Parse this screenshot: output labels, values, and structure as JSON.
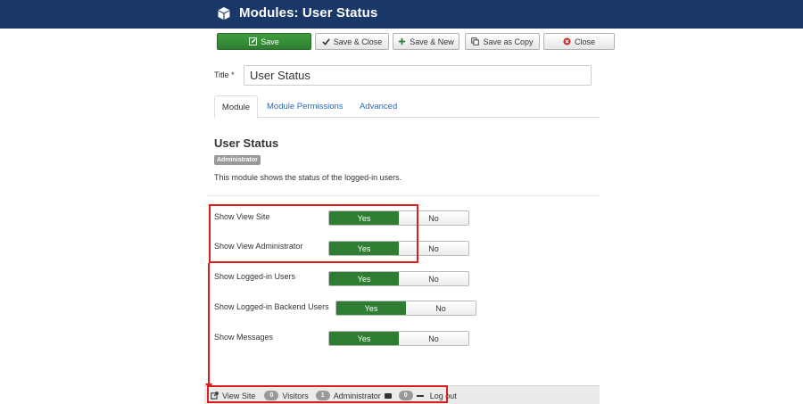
{
  "header": {
    "title": "Modules: User Status"
  },
  "toolbar": {
    "save": "Save",
    "save_close": "Save & Close",
    "save_new": "Save & New",
    "save_copy": "Save as Copy",
    "close": "Close"
  },
  "form": {
    "title_label": "Title *",
    "title_value": "User Status"
  },
  "tabs": [
    "Module",
    "Module Permissions",
    "Advanced"
  ],
  "module": {
    "heading": "User Status",
    "client_badge": "Administrator",
    "description": "This module shows the status of the logged-in users."
  },
  "options": [
    {
      "label": "Show View Site",
      "yes": "Yes",
      "no": "No",
      "value": "Yes"
    },
    {
      "label": "Show View Administrator",
      "yes": "Yes",
      "no": "No",
      "value": "Yes"
    },
    {
      "label": "Show Logged-in Users",
      "yes": "Yes",
      "no": "No",
      "value": "Yes"
    },
    {
      "label": "Show Logged-in Backend Users",
      "yes": "Yes",
      "no": "No",
      "value": "Yes"
    },
    {
      "label": "Show Messages",
      "yes": "Yes",
      "no": "No",
      "value": "Yes"
    }
  ],
  "status_bar": {
    "view_site": "View Site",
    "visitors_count": "0",
    "visitors": "Visitors",
    "admin_count": "1",
    "administrator": "Administrator",
    "messages_count": "0",
    "logout": "Log out"
  },
  "colors": {
    "header_bg": "#1a3867",
    "save_green": "#2f7d32",
    "highlight_red": "#e01b1b",
    "link_blue": "#2a69b8"
  },
  "icons": [
    "cube-icon",
    "check-icon",
    "plus-icon",
    "copy-icon",
    "close-circle-icon",
    "external-link-icon",
    "envelope-icon",
    "dash-icon"
  ]
}
